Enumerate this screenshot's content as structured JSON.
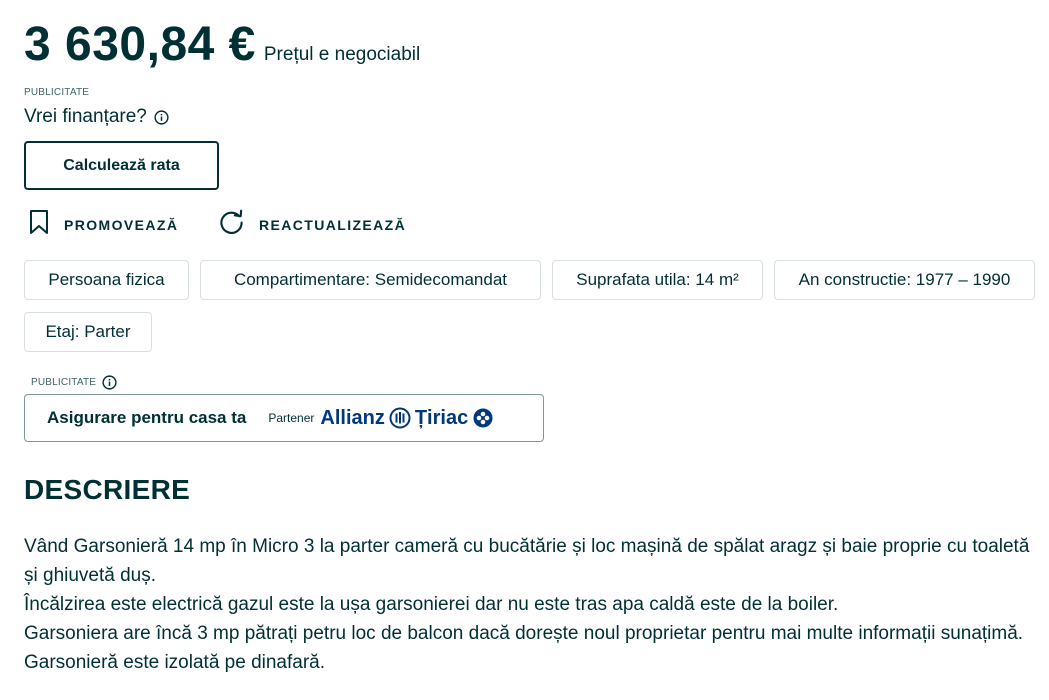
{
  "price": {
    "amount": "3 630,84 €",
    "note": "Prețul e negociabil"
  },
  "ad_labels": {
    "top": "PUBLICITATE",
    "insurance": "PUBLICITATE"
  },
  "finance": {
    "question": "Vrei finanțare?",
    "button_label": "Calculează rata"
  },
  "actions": {
    "promote": "PROMOVEAZĂ",
    "refresh": "REACTUALIZEAZĂ"
  },
  "tags": [
    "Persoana fizica",
    "Compartimentare: Semidecomandat",
    "Suprafata utila: 14 m²",
    "An constructie: 1977 – 1990",
    "Etaj: Parter"
  ],
  "insurance": {
    "text": "Asigurare pentru casa ta",
    "partner_label": "Partener",
    "brand_1": "Allianz",
    "brand_2": "Țiriac"
  },
  "description": {
    "title": "DESCRIERE",
    "lines": [
      "Vând Garsonieră 14 mp în Micro 3 la parter cameră cu bucătărie și loc mașină de spălat aragz și baie proprie cu toaletă și ghiuvetă duș.",
      "Încălzirea este electrică gazul este la ușa garsonierei dar nu este tras apa caldă este de la boiler.",
      "Garsoniera are încă 3 mp pătrați petru loc de balcon dacă dorește noul proprietar pentru mai multe informații sunațimă. Garsonieră este izolată pe dinafară."
    ]
  },
  "colors": {
    "text": "#002f34",
    "border": "#d8dfe0",
    "brand": "#003781"
  },
  "icons": [
    "info-icon",
    "bookmark-icon",
    "refresh-icon",
    "allianz-eagle-icon",
    "tiriac-logo-icon"
  ]
}
